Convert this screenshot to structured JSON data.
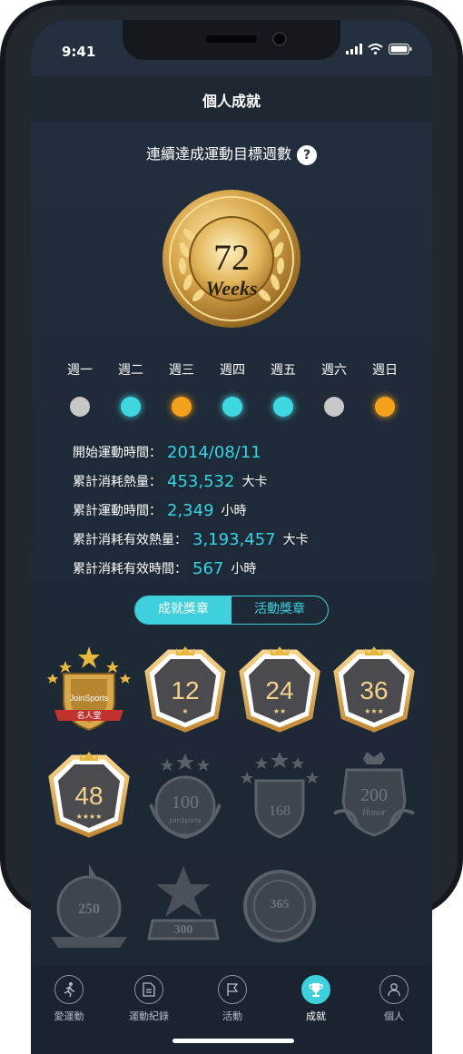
{
  "status_bar": {
    "time": "9:41"
  },
  "header": {
    "title": "個人成就"
  },
  "goal": {
    "label": "連續達成運動目標週數",
    "help_icon": "?"
  },
  "medal": {
    "weeks_value": "72",
    "weeks_unit": "Weeks"
  },
  "week_days": [
    {
      "label": "週一",
      "status_color": "#c8c8c8"
    },
    {
      "label": "週二",
      "status_color": "#3ed7e0"
    },
    {
      "label": "週三",
      "status_color": "#f5a01a"
    },
    {
      "label": "週四",
      "status_color": "#3ed7e0"
    },
    {
      "label": "週五",
      "status_color": "#3ed7e0"
    },
    {
      "label": "週六",
      "status_color": "#c8c8c8"
    },
    {
      "label": "週日",
      "status_color": "#f5a01a"
    }
  ],
  "stats": [
    {
      "label": "開始運動時間：",
      "value": "2014/08/11",
      "unit": ""
    },
    {
      "label": "累計消耗熱量：",
      "value": "453,532",
      "unit": "大卡"
    },
    {
      "label": "累計運動時間：",
      "value": "2,349",
      "unit": "小時"
    },
    {
      "label": "累計消耗有效熱量：",
      "value": "3,193,457",
      "unit": "大卡"
    },
    {
      "label": "累計消耗有效時間：",
      "value": "567",
      "unit": "小時"
    }
  ],
  "segment": {
    "active": "成就獎章",
    "inactive": "活動獎章"
  },
  "badges": {
    "famous_ribbon": "名人堂",
    "famous_brand": "JoinSports",
    "hex": [
      {
        "number": "12",
        "stars": "★"
      },
      {
        "number": "24",
        "stars": "★★"
      },
      {
        "number": "36",
        "stars": "★★★"
      },
      {
        "number": "48",
        "stars": "★★★★"
      }
    ],
    "locked": [
      "100",
      "168",
      "200",
      "250",
      "300",
      "365"
    ],
    "locked_sub_100": "JoinSports",
    "locked_sub_200": "Honor"
  },
  "tabbar": {
    "items": [
      {
        "label": "愛運動"
      },
      {
        "label": "運動紀錄"
      },
      {
        "label": "活動"
      },
      {
        "label": "成就"
      },
      {
        "label": "個人"
      }
    ]
  },
  "colors": {
    "accent": "#3ed0dd",
    "gold": "#d9a84a",
    "background": "#1f2a38"
  }
}
